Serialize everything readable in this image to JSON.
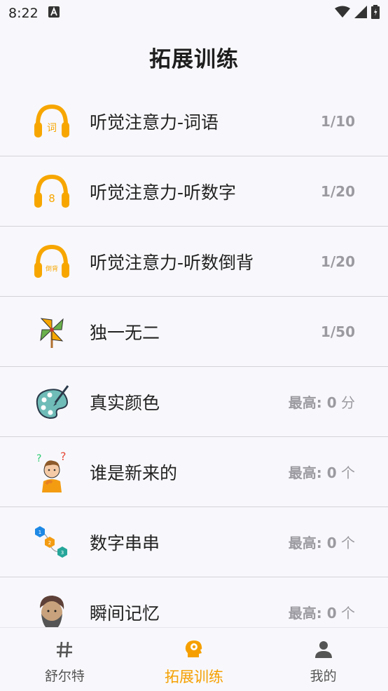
{
  "status_bar": {
    "time": "8:22"
  },
  "header": {
    "title": "拓展训练"
  },
  "list": [
    {
      "icon": "headphones-ci-icon",
      "icon_text": "词",
      "label": "听觉注意力-词语",
      "value": "1/10",
      "unit": ""
    },
    {
      "icon": "headphones-eight-icon",
      "icon_text": "8",
      "label": "听觉注意力-听数字",
      "value": "1/20",
      "unit": ""
    },
    {
      "icon": "headphones-reverse-icon",
      "icon_text": "倒背",
      "label": "听觉注意力-听数倒背",
      "value": "1/20",
      "unit": ""
    },
    {
      "icon": "pinwheel-icon",
      "label": "独一无二",
      "value": "1/50",
      "unit": ""
    },
    {
      "icon": "paint-palette-icon",
      "label": "真实颜色",
      "value": "最高: 0",
      "unit": " 分"
    },
    {
      "icon": "confused-person-icon",
      "label": "谁是新来的",
      "value": "最高: 0",
      "unit": " 个"
    },
    {
      "icon": "number-chain-icon",
      "icon_text": [
        "1",
        "2",
        "3"
      ],
      "label": "数字串串",
      "value": "最高: 0",
      "unit": " 个"
    },
    {
      "icon": "bearded-person-icon",
      "label": "瞬间记忆",
      "value": "最高: 0",
      "unit": " 个"
    }
  ],
  "bottom_nav": [
    {
      "icon": "hash-icon",
      "label": "舒尔特",
      "active": false
    },
    {
      "icon": "brain-gear-icon",
      "label": "拓展训练",
      "active": true
    },
    {
      "icon": "person-icon",
      "label": "我的",
      "active": false
    }
  ],
  "colors": {
    "accent": "#f5a000",
    "muted": "#9a9aa0",
    "divider": "#d2d2d8"
  }
}
